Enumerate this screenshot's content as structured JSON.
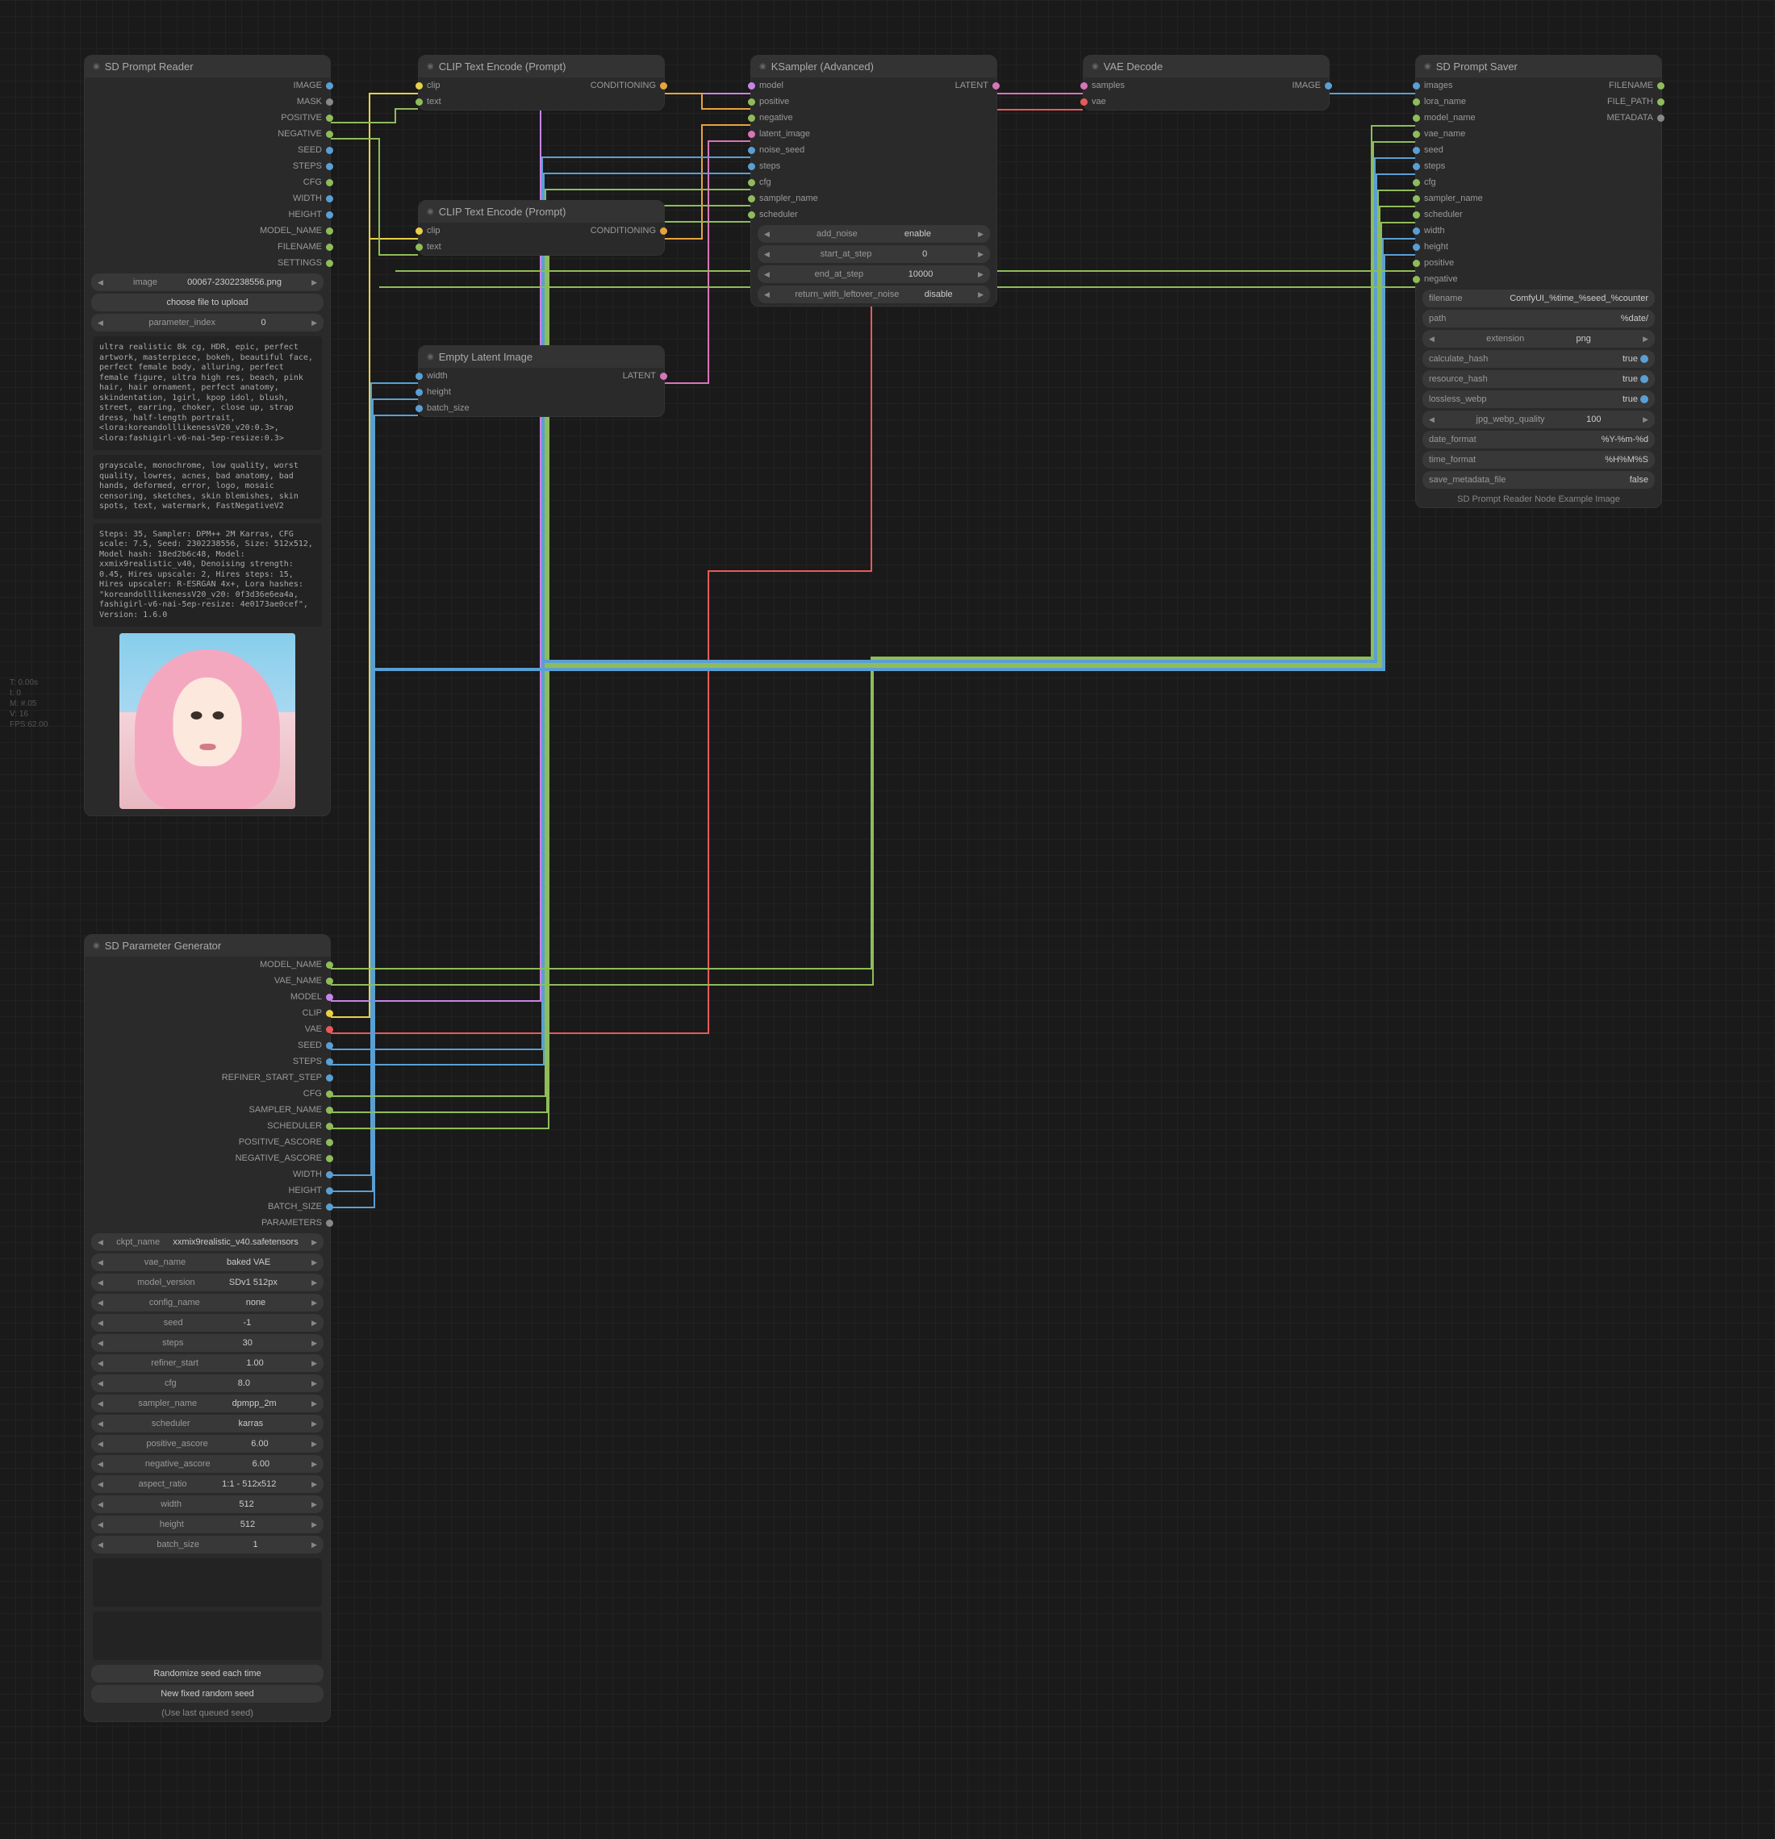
{
  "stats": {
    "t": "T: 0.00s",
    "i": "I: 0",
    "m": "M: #.05",
    "v": "V: 16",
    "fps": "FPS:62.00"
  },
  "reader": {
    "title": "SD Prompt Reader",
    "outs": [
      "IMAGE",
      "MASK",
      "POSITIVE",
      "NEGATIVE",
      "SEED",
      "STEPS",
      "CFG",
      "WIDTH",
      "HEIGHT",
      "MODEL_NAME",
      "FILENAME",
      "SETTINGS"
    ],
    "image_widget": {
      "l": "image",
      "v": "00067-2302238556.png"
    },
    "upload": "choose file to upload",
    "param_idx": {
      "l": "parameter_index",
      "v": "0"
    },
    "pos": "ultra realistic 8k cg, HDR, epic, perfect artwork, masterpiece, bokeh, beautiful face, perfect female body, alluring, perfect female figure, ultra high res, beach, pink hair, hair ornament, perfect anatomy, skindentation, 1girl, kpop idol, blush, street, earring, choker, close up, strap dress, half-length portrait, <lora:koreandolllikenessV20_v20:0.3>, <lora:fashigirl-v6-nai-5ep-resize:0.3>",
    "neg": "grayscale, monochrome, low quality, worst quality, lowres, acnes, bad anatomy, bad hands, deformed, error, logo, mosaic censoring, sketches, skin blemishes, skin spots, text, watermark, FastNegativeV2",
    "settings": "Steps: 35, Sampler: DPM++ 2M Karras, CFG scale: 7.5, Seed: 2302238556, Size: 512x512, Model hash: 18ed2b6c48, Model: xxmix9realistic_v40, Denoising strength: 0.45, Hires upscale: 2, Hires steps: 15, Hires upscaler: R-ESRGAN 4x+, Lora hashes: \"koreandolllikenessV20_v20: 0f3d36e6ea4a, fashigirl-v6-nai-5ep-resize: 4e0173ae0cef\", Version: 1.6.0"
  },
  "clip1": {
    "title": "CLIP Text Encode (Prompt)",
    "ins": [
      "clip",
      "text"
    ],
    "out": "CONDITIONING"
  },
  "clip2": {
    "title": "CLIP Text Encode (Prompt)",
    "ins": [
      "clip",
      "text"
    ],
    "out": "CONDITIONING"
  },
  "latent": {
    "title": "Empty Latent Image",
    "ins": [
      "width",
      "height",
      "batch_size"
    ],
    "out": "LATENT"
  },
  "ksampler": {
    "title": "KSampler (Advanced)",
    "out": "LATENT",
    "ins": [
      "model",
      "positive",
      "negative",
      "latent_image",
      "noise_seed",
      "steps",
      "cfg",
      "sampler_name",
      "scheduler"
    ],
    "w": [
      {
        "l": "add_noise",
        "v": "enable"
      },
      {
        "l": "start_at_step",
        "v": "0"
      },
      {
        "l": "end_at_step",
        "v": "10000"
      },
      {
        "l": "return_with_leftover_noise",
        "v": "disable"
      }
    ]
  },
  "vae": {
    "title": "VAE Decode",
    "ins": [
      "samples",
      "vae"
    ],
    "out": "IMAGE"
  },
  "saver": {
    "title": "SD Prompt Saver",
    "outs": [
      "FILENAME",
      "FILE_PATH",
      "METADATA"
    ],
    "ins": [
      "images",
      "lora_name",
      "model_name",
      "vae_name",
      "seed",
      "steps",
      "cfg",
      "sampler_name",
      "scheduler",
      "width",
      "height",
      "positive",
      "negative"
    ],
    "w": [
      {
        "l": "filename",
        "v": "ComfyUI_%time_%seed_%counter",
        "t": "txt"
      },
      {
        "l": "path",
        "v": "%date/",
        "t": "txt"
      },
      {
        "l": "extension",
        "v": "png"
      },
      {
        "l": "calculate_hash",
        "v": "true",
        "b": true
      },
      {
        "l": "resource_hash",
        "v": "true",
        "b": true
      },
      {
        "l": "lossless_webp",
        "v": "true",
        "b": true
      },
      {
        "l": "jpg_webp_quality",
        "v": "100"
      },
      {
        "l": "date_format",
        "v": "%Y-%m-%d",
        "t": "txt"
      },
      {
        "l": "time_format",
        "v": "%H%M%S",
        "t": "txt"
      },
      {
        "l": "save_metadata_file",
        "v": "false",
        "t": "txt"
      }
    ],
    "footer": "SD Prompt Reader Node Example Image"
  },
  "paramgen": {
    "title": "SD Parameter Generator",
    "outs": [
      "MODEL_NAME",
      "VAE_NAME",
      "MODEL",
      "CLIP",
      "VAE",
      "SEED",
      "STEPS",
      "REFINER_START_STEP",
      "CFG",
      "SAMPLER_NAME",
      "SCHEDULER",
      "POSITIVE_ASCORE",
      "NEGATIVE_ASCORE",
      "WIDTH",
      "HEIGHT",
      "BATCH_SIZE",
      "PARAMETERS"
    ],
    "w": [
      {
        "l": "ckpt_name",
        "v": "xxmix9realistic_v40.safetensors"
      },
      {
        "l": "vae_name",
        "v": "baked VAE"
      },
      {
        "l": "model_version",
        "v": "SDv1 512px"
      },
      {
        "l": "config_name",
        "v": "none"
      },
      {
        "l": "seed",
        "v": "-1"
      },
      {
        "l": "steps",
        "v": "30"
      },
      {
        "l": "refiner_start",
        "v": "1.00"
      },
      {
        "l": "cfg",
        "v": "8.0"
      },
      {
        "l": "sampler_name",
        "v": "dpmpp_2m"
      },
      {
        "l": "scheduler",
        "v": "karras"
      },
      {
        "l": "positive_ascore",
        "v": "6.00"
      },
      {
        "l": "negative_ascore",
        "v": "6.00"
      },
      {
        "l": "aspect_ratio",
        "v": "1:1 - 512x512"
      },
      {
        "l": "width",
        "v": "512"
      },
      {
        "l": "height",
        "v": "512"
      },
      {
        "l": "batch_size",
        "v": "1"
      }
    ],
    "btn1": "Randomize seed each time",
    "btn2": "New fixed random seed",
    "footer": "(Use last queued seed)"
  },
  "colors": {
    "image": "#5a9fd4",
    "mask": "#888",
    "positive": "#8fbc5a",
    "negative": "#8fbc5a",
    "seed": "#5a9fd4",
    "steps": "#5a9fd4",
    "cfg": "#8fbc5a",
    "width": "#5a9fd4",
    "height": "#5a9fd4",
    "model_name": "#8fbc5a",
    "vae_name": "#8fbc5a",
    "filename": "#8fbc5a",
    "settings": "#8fbc5a",
    "conditioning": "#e8a33d",
    "clip": "#e8d04a",
    "text": "#8fbc5a",
    "latent": "#d874b8",
    "model": "#c785e8",
    "vae": "#e85a5a",
    "samples": "#d874b8",
    "sampler_name": "#8fbc5a",
    "scheduler": "#8fbc5a",
    "batch_size": "#5a9fd4",
    "lora_name": "#8fbc5a",
    "parameters": "#888",
    "refiner": "#5a9fd4",
    "ascore": "#8fbc5a",
    "file_path": "#8fbc5a",
    "metadata": "#888",
    "noise_seed": "#5a9fd4",
    "latent_image": "#d874b8"
  }
}
